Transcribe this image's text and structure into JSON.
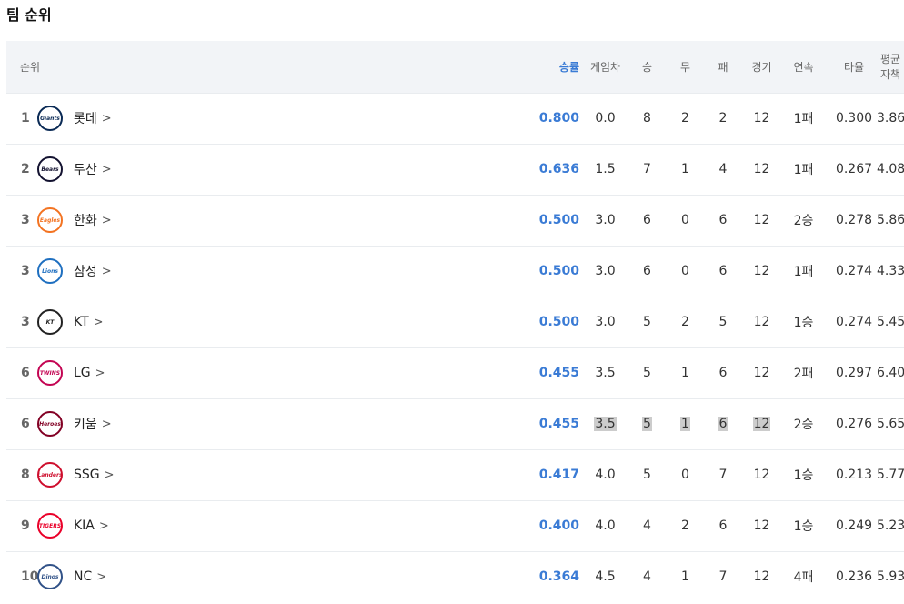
{
  "title": "팀 순위",
  "headers": {
    "rank": "순위",
    "pct": "승률",
    "gb": "게임차",
    "w": "승",
    "d": "무",
    "l": "패",
    "g": "경기",
    "streak": "연속",
    "avg": "타율",
    "era": "평균자책"
  },
  "rows": [
    {
      "rank": "1",
      "team": "롯데",
      "pct": "0.800",
      "gb": "0.0",
      "w": "8",
      "d": "2",
      "l": "2",
      "g": "12",
      "streak": "1패",
      "avg": "0.300",
      "era": "3.86",
      "logo_color": "#0a2a55",
      "logo_text": "Giants",
      "logo_icon": "lotte-giants-logo"
    },
    {
      "rank": "2",
      "team": "두산",
      "pct": "0.636",
      "gb": "1.5",
      "w": "7",
      "d": "1",
      "l": "4",
      "g": "12",
      "streak": "1패",
      "avg": "0.267",
      "era": "4.08",
      "logo_color": "#131230",
      "logo_text": "Bears",
      "logo_icon": "doosan-bears-logo"
    },
    {
      "rank": "3",
      "team": "한화",
      "pct": "0.500",
      "gb": "3.0",
      "w": "6",
      "d": "0",
      "l": "6",
      "g": "12",
      "streak": "2승",
      "avg": "0.278",
      "era": "5.86",
      "logo_color": "#f37321",
      "logo_text": "Eagles",
      "logo_icon": "hanwha-eagles-logo"
    },
    {
      "rank": "3",
      "team": "삼성",
      "pct": "0.500",
      "gb": "3.0",
      "w": "6",
      "d": "0",
      "l": "6",
      "g": "12",
      "streak": "1패",
      "avg": "0.274",
      "era": "4.33",
      "logo_color": "#1e6fc0",
      "logo_text": "Lions",
      "logo_icon": "samsung-lions-logo"
    },
    {
      "rank": "3",
      "team": "KT",
      "pct": "0.500",
      "gb": "3.0",
      "w": "5",
      "d": "2",
      "l": "5",
      "g": "12",
      "streak": "1승",
      "avg": "0.274",
      "era": "5.45",
      "logo_color": "#222222",
      "logo_text": "KT",
      "logo_icon": "kt-wiz-logo"
    },
    {
      "rank": "6",
      "team": "LG",
      "pct": "0.455",
      "gb": "3.5",
      "w": "5",
      "d": "1",
      "l": "6",
      "g": "12",
      "streak": "2패",
      "avg": "0.297",
      "era": "6.40",
      "logo_color": "#c30452",
      "logo_text": "TWINS",
      "logo_icon": "lg-twins-logo"
    },
    {
      "rank": "6",
      "team": "키움",
      "pct": "0.455",
      "gb": "3.5",
      "w": "5",
      "d": "1",
      "l": "6",
      "g": "12",
      "streak": "2승",
      "avg": "0.276",
      "era": "5.65",
      "logo_color": "#820024",
      "logo_text": "Heroes",
      "logo_icon": "kiwoom-heroes-logo"
    },
    {
      "rank": "8",
      "team": "SSG",
      "pct": "0.417",
      "gb": "4.0",
      "w": "5",
      "d": "0",
      "l": "7",
      "g": "12",
      "streak": "1승",
      "avg": "0.213",
      "era": "5.77",
      "logo_color": "#ce0e2d",
      "logo_text": "Landers",
      "logo_icon": "ssg-landers-logo"
    },
    {
      "rank": "9",
      "team": "KIA",
      "pct": "0.400",
      "gb": "4.0",
      "w": "4",
      "d": "2",
      "l": "6",
      "g": "12",
      "streak": "1승",
      "avg": "0.249",
      "era": "5.23",
      "logo_color": "#ea0029",
      "logo_text": "TIGERS",
      "logo_icon": "kia-tigers-logo"
    },
    {
      "rank": "10",
      "team": "NC",
      "pct": "0.364",
      "gb": "4.5",
      "w": "4",
      "d": "1",
      "l": "7",
      "g": "12",
      "streak": "4패",
      "avg": "0.236",
      "era": "5.93",
      "logo_color": "#315288",
      "logo_text": "Dinos",
      "logo_icon": "nc-dinos-logo"
    }
  ],
  "colors": {
    "accent": "#3a7bd5",
    "header_bg": "#f2f4f7",
    "highlight": "#cccccc"
  }
}
